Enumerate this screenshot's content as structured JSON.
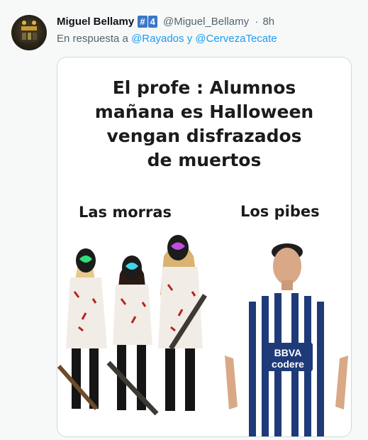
{
  "tweet": {
    "author_name": "Miguel Bellamy",
    "badge_hash": "#",
    "badge_num": "4",
    "handle": "@Miguel_Bellamy",
    "separator": "·",
    "time": "8h",
    "reply_prefix": "En respuesta a",
    "reply_to_1": "@Rayados",
    "reply_and": "y",
    "reply_to_2": "@CervezaTecate"
  },
  "meme": {
    "caption_lines": [
      "El profe : Alumnos",
      "mañana es Halloween",
      "vengan disfrazados",
      "de muertos"
    ],
    "left_label": "Las morras",
    "right_label": "Los pibes",
    "jersey_sponsor_top": "BBVA",
    "jersey_sponsor_bottom": "codere"
  }
}
